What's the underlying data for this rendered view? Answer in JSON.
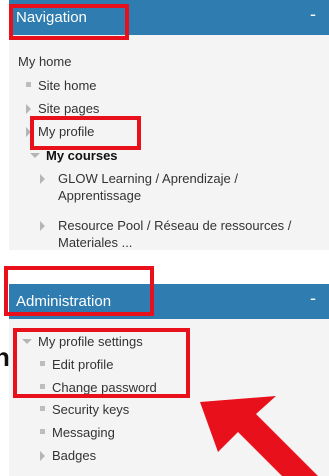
{
  "navigation": {
    "title": "Navigation",
    "collapse": "-",
    "items": [
      {
        "label": "My home"
      },
      {
        "label": "Site home"
      },
      {
        "label": "Site pages"
      },
      {
        "label": "My profile"
      },
      {
        "label": "My courses"
      },
      {
        "label": "GLOW Learning / Aprendizaje / Apprentissage"
      },
      {
        "label": "Resource Pool / Réseau de ressources / Materiales ..."
      }
    ]
  },
  "administration": {
    "title": "Administration",
    "collapse": "-",
    "items": [
      {
        "label": "My profile settings"
      },
      {
        "label": "Edit profile"
      },
      {
        "label": "Change password"
      },
      {
        "label": "Security keys"
      },
      {
        "label": "Messaging"
      },
      {
        "label": "Badges"
      }
    ]
  },
  "overlay_fragment": "n",
  "annotation": {
    "highlight_color": "#e8111b",
    "arrow_color": "#e8111b"
  }
}
